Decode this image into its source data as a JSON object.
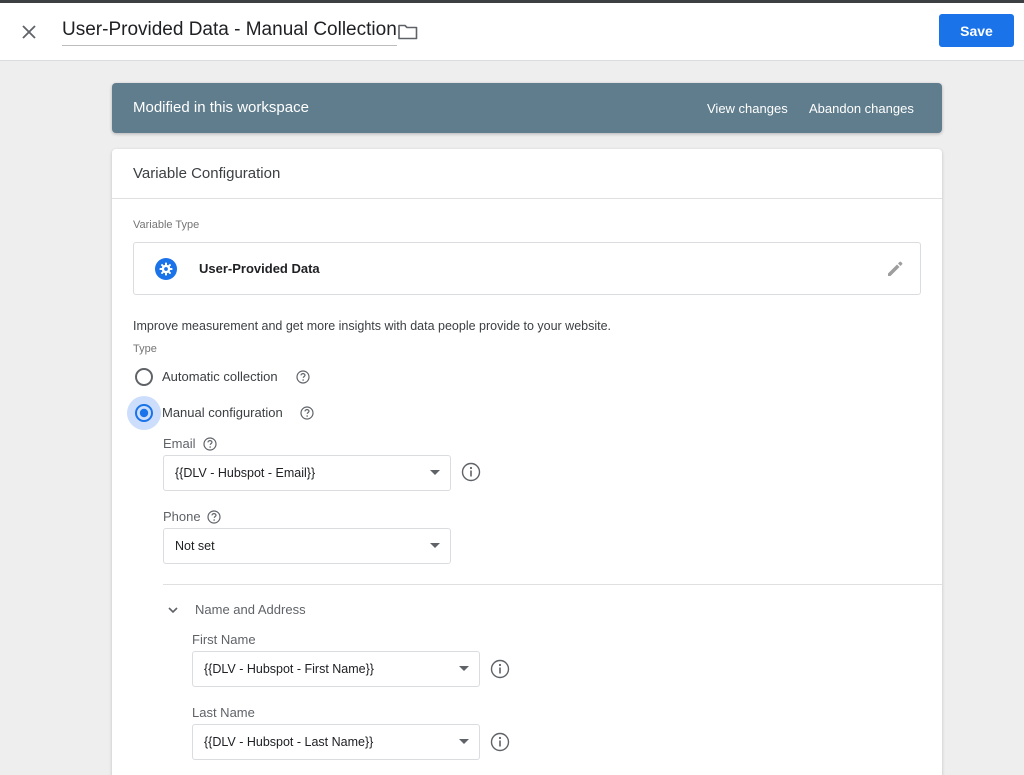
{
  "header": {
    "title": "User-Provided Data - Manual Collection",
    "save_label": "Save"
  },
  "banner": {
    "text": "Modified in this workspace",
    "view_changes": "View changes",
    "abandon_changes": "Abandon changes"
  },
  "card": {
    "title": "Variable Configuration",
    "variable_type_label": "Variable Type",
    "variable_type_name": "User-Provided Data",
    "description": "Improve measurement and get more insights with data people provide to your website.",
    "type_label": "Type",
    "options": [
      {
        "label": "Automatic collection",
        "selected": false
      },
      {
        "label": "Manual configuration",
        "selected": true
      }
    ],
    "email": {
      "label": "Email",
      "value": "{{DLV - Hubspot - Email}}"
    },
    "phone": {
      "label": "Phone",
      "value": "Not set"
    },
    "name_and_address": {
      "title": "Name and Address",
      "first_name": {
        "label": "First Name",
        "value": "{{DLV - Hubspot - First Name}}"
      },
      "last_name": {
        "label": "Last Name",
        "value": "{{DLV - Hubspot - Last Name}}"
      }
    }
  },
  "colors": {
    "accent": "#1a73e8",
    "banner": "#5f7d8c"
  },
  "icons": [
    "close-icon",
    "folder-icon",
    "gear-icon",
    "edit-icon",
    "help-icon",
    "info-icon",
    "chevron-down-icon"
  ]
}
